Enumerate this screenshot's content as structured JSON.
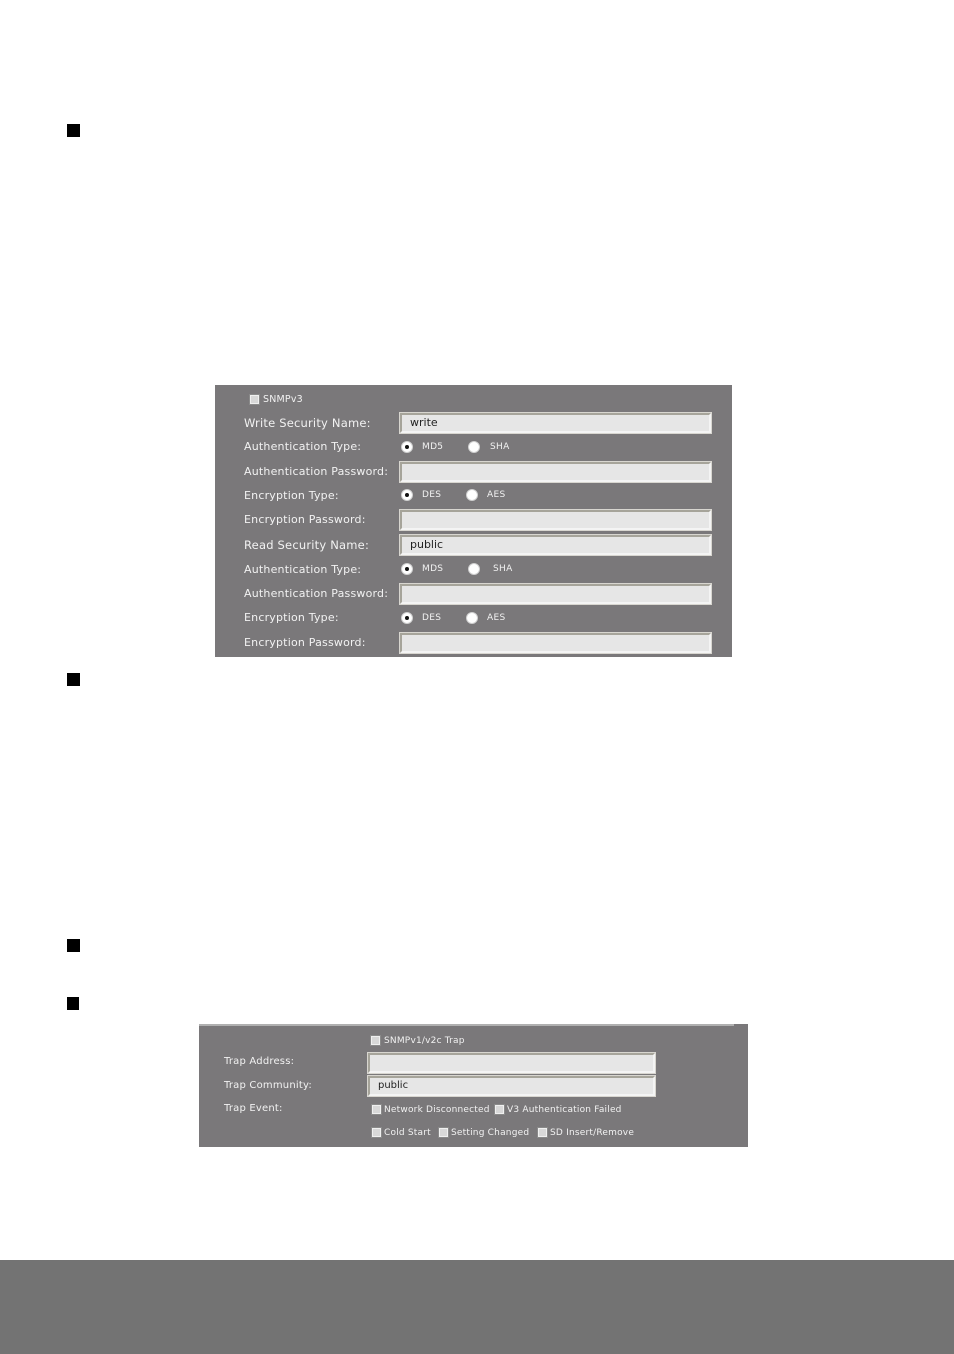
{
  "colors": {
    "panel_bg": "#7a787a",
    "field_bg": "#e6e6e6",
    "footer_bg": "#737373",
    "bullet": "#000000"
  },
  "bullets": [
    {
      "icon": "square-bullet-icon"
    },
    {
      "icon": "square-bullet-icon"
    },
    {
      "icon": "square-bullet-icon"
    },
    {
      "icon": "square-bullet-icon"
    }
  ],
  "snmpv3": {
    "enable_label": "SNMPv3",
    "enabled": false,
    "write": {
      "security_name_label": "Write Security Name:",
      "security_name_value": "write",
      "auth_type_label": "Authentication Type:",
      "auth_options": [
        "MD5",
        "SHA"
      ],
      "auth_selected": "MD5",
      "auth_password_label": "Authentication Password:",
      "auth_password_value": "",
      "enc_type_label": "Encryption Type:",
      "enc_options": [
        "DES",
        "AES"
      ],
      "enc_selected": "DES",
      "enc_password_label": "Encryption Password:",
      "enc_password_value": ""
    },
    "read": {
      "security_name_label": "Read Security Name:",
      "security_name_value": "public",
      "auth_type_label": "Authentication Type:",
      "auth_options": [
        "MDS",
        "SHA"
      ],
      "auth_selected": "MDS",
      "auth_password_label": "Authentication Password:",
      "auth_password_value": "",
      "enc_type_label": "Encryption Type:",
      "enc_options": [
        "DES",
        "AES"
      ],
      "enc_selected": "DES",
      "enc_password_label": "Encryption Password:",
      "enc_password_value": ""
    }
  },
  "trap": {
    "enable_label": "SNMPv1/v2c Trap",
    "enabled": false,
    "address_label": "Trap Address:",
    "address_value": "",
    "community_label": "Trap Community:",
    "community_value": "public",
    "event_label": "Trap Event:",
    "events": [
      {
        "label": "Network Disconnected",
        "checked": false
      },
      {
        "label": "V3 Authentication Failed",
        "checked": false
      },
      {
        "label": "Cold Start",
        "checked": false
      },
      {
        "label": "Setting Changed",
        "checked": false
      },
      {
        "label": "SD Insert/Remove",
        "checked": false
      }
    ]
  }
}
